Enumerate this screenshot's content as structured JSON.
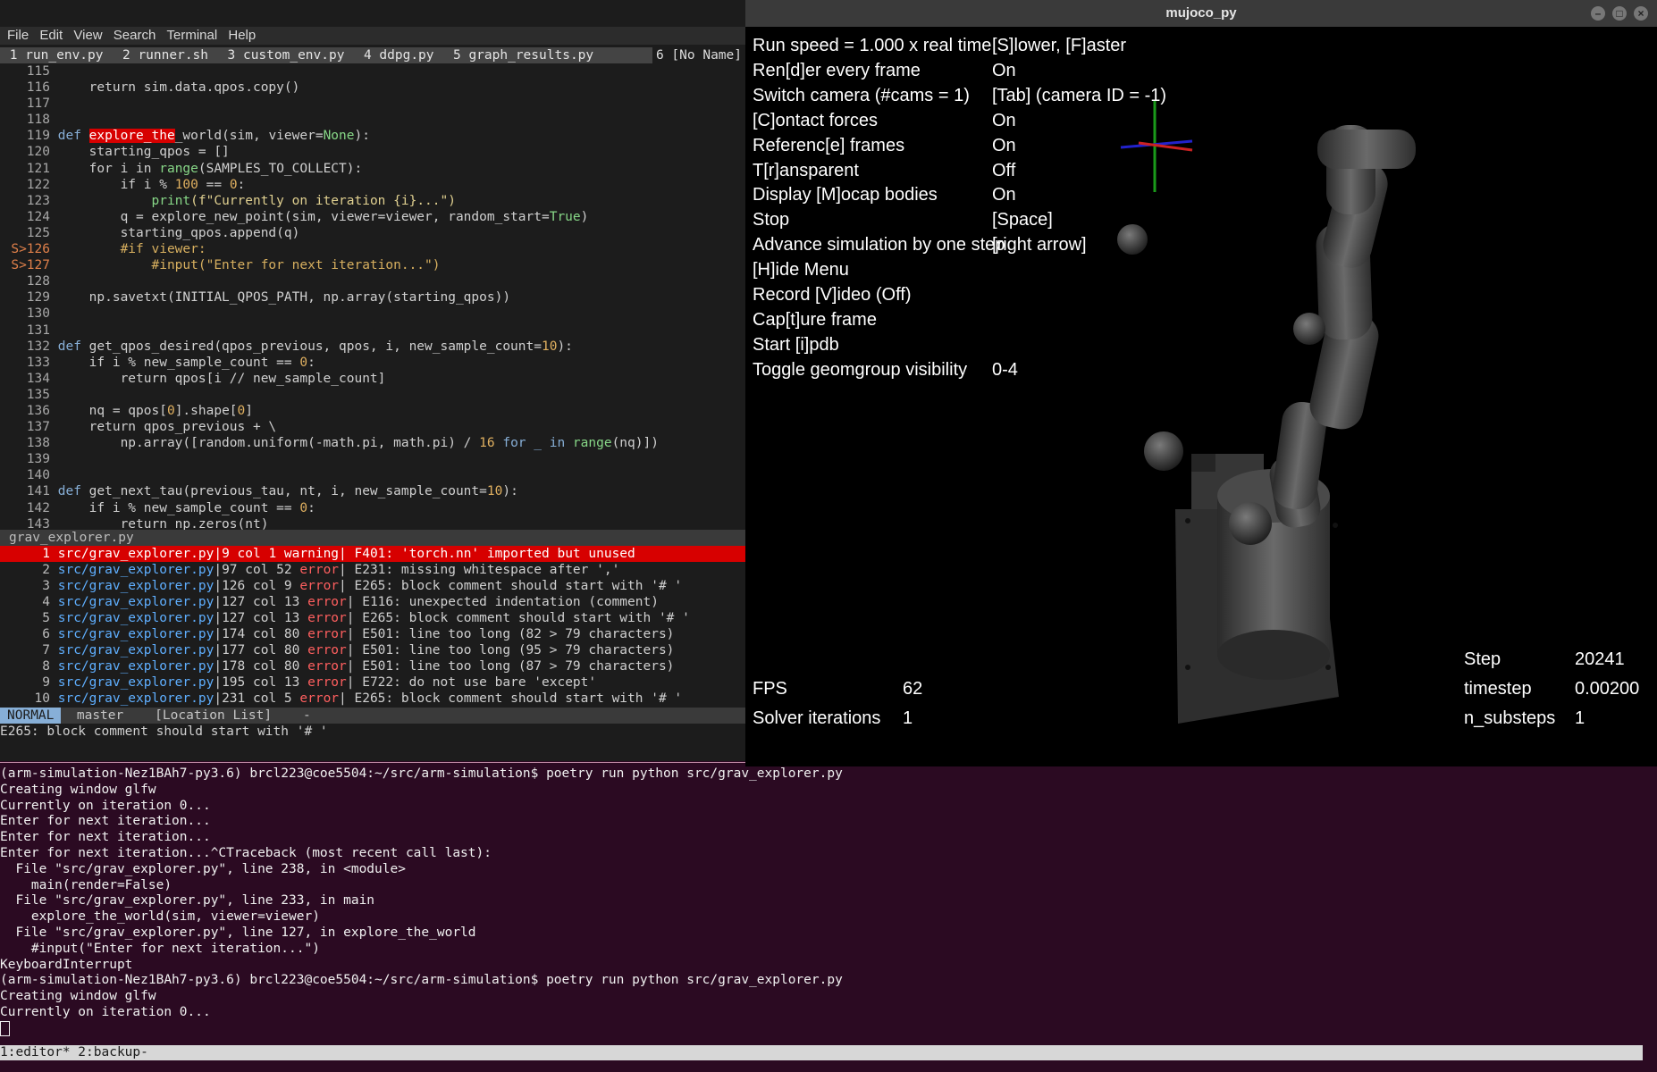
{
  "menubar": [
    "File",
    "Edit",
    "View",
    "Search",
    "Terminal",
    "Help"
  ],
  "tabs": [
    {
      "num": "1",
      "label": "run_env.py"
    },
    {
      "num": "2",
      "label": "runner.sh"
    },
    {
      "num": "3",
      "label": "custom_env.py"
    },
    {
      "num": "4",
      "label": "ddpg.py"
    },
    {
      "num": "5",
      "label": "graph_results.py"
    },
    {
      "num": "6",
      "label": "[No Name]"
    }
  ],
  "code": {
    "l115": "115",
    "l116": "116",
    "l117": "117",
    "l118": "118",
    "l119": "119",
    "l120": "120",
    "l121": "121",
    "l122": "122",
    "l123": "123",
    "l124": "124",
    "l125": "125",
    "l126": "S>126",
    "l127": "S>127",
    "l128": "128",
    "l129": "129",
    "l130": "130",
    "l131": "131",
    "l132": "132",
    "l133": "133",
    "l134": "134",
    "l135": "135",
    "l136": "136",
    "l137": "137",
    "l138": "138",
    "l139": "139",
    "l140": "140",
    "l141": "141",
    "l142": "142",
    "l143": "143",
    "t116": "    return sim.data.qpos.copy()",
    "t119_def": "def ",
    "t119_name": "explore_the",
    "t119_rest": "_world(sim, viewer=",
    "t119_none": "None",
    "t119_end": "):",
    "t120": "    starting_qpos = []",
    "t121_a": "    for i in ",
    "t121_b": "range",
    "t121_c": "(SAMPLES_TO_COLLECT):",
    "t122_a": "        if i % ",
    "t122_b": "100",
    "t122_c": " == ",
    "t122_d": "0",
    "t122_e": ":",
    "t123_a": "            ",
    "t123_b": "print",
    "t123_c": "(f\"Currently on iteration {i}...\")",
    "t124_a": "        q = explore_new_point(sim, viewer=viewer, random_start=",
    "t124_b": "True",
    "t124_c": ")",
    "t125": "        starting_qpos.append(q)",
    "t126": "        #if viewer:",
    "t127": "            #input(\"Enter for next iteration...\")",
    "t129": "    np.savetxt(INITIAL_QPOS_PATH, np.array(starting_qpos))",
    "t132_a": "def ",
    "t132_b": "get_qpos_desired(qpos_previous, qpos, i, new_sample_count=",
    "t132_c": "10",
    "t132_d": "):",
    "t133_a": "    if i % new_sample_count == ",
    "t133_b": "0",
    "t133_c": ":",
    "t134": "        return qpos[i // new_sample_count]",
    "t136_a": "    nq = qpos[",
    "t136_b": "0",
    "t136_c": "].shape[",
    "t136_d": "0",
    "t136_e": "]",
    "t137": "    return qpos_previous + \\",
    "t138_a": "        np.array([random.uniform(-math.pi, math.pi) / ",
    "t138_b": "16",
    "t138_c": " for _ in ",
    "t138_d": "range",
    "t138_e": "(nq)])",
    "t141_a": "def ",
    "t141_b": "get_next_tau(previous_tau, nt, i, new_sample_count=",
    "t141_c": "10",
    "t141_d": "):",
    "t142_a": "    if i % new_sample_count == ",
    "t142_b": "0",
    "t142_c": ":",
    "t143": "        return np.zeros(nt)"
  },
  "status1": "grav_explorer.py",
  "loclist": [
    {
      "n": "1",
      "file": "src/grav_explorer.py",
      "pos": "|9 col 1 ",
      "level": "warning",
      "msg": "| F401: 'torch.nn' imported but unused"
    },
    {
      "n": "2",
      "file": "src/grav_explorer.py",
      "pos": "|97 col 52 ",
      "level": "error",
      "msg": "| E231: missing whitespace after ','"
    },
    {
      "n": "3",
      "file": "src/grav_explorer.py",
      "pos": "|126 col 9 ",
      "level": "error",
      "msg": "| E265: block comment should start with '# '"
    },
    {
      "n": "4",
      "file": "src/grav_explorer.py",
      "pos": "|127 col 13 ",
      "level": "error",
      "msg": "| E116: unexpected indentation (comment)"
    },
    {
      "n": "5",
      "file": "src/grav_explorer.py",
      "pos": "|127 col 13 ",
      "level": "error",
      "msg": "| E265: block comment should start with '# '"
    },
    {
      "n": "6",
      "file": "src/grav_explorer.py",
      "pos": "|174 col 80 ",
      "level": "error",
      "msg": "| E501: line too long (82 > 79 characters)"
    },
    {
      "n": "7",
      "file": "src/grav_explorer.py",
      "pos": "|177 col 80 ",
      "level": "error",
      "msg": "| E501: line too long (95 > 79 characters)"
    },
    {
      "n": "8",
      "file": "src/grav_explorer.py",
      "pos": "|178 col 80 ",
      "level": "error",
      "msg": "| E501: line too long (87 > 79 characters)"
    },
    {
      "n": "9",
      "file": "src/grav_explorer.py",
      "pos": "|195 col 13 ",
      "level": "error",
      "msg": "| E722: do not use bare 'except'"
    },
    {
      "n": "10",
      "file": "src/grav_explorer.py",
      "pos": "|231 col 5 ",
      "level": "error",
      "msg": "| E265: block comment should start with '# '"
    }
  ],
  "status2": {
    "mode": "NORMAL",
    "branch": "master",
    "buffer": "[Location List]",
    "flag": "-"
  },
  "cmdline": "E265: block comment should start with '# '",
  "terminal": [
    "(arm-simulation-Nez1BAh7-py3.6) brcl223@coe5504:~/src/arm-simulation$ poetry run python src/grav_explorer.py",
    "Creating window glfw",
    "Currently on iteration 0...",
    "Enter for next iteration...",
    "Enter for next iteration...",
    "Enter for next iteration...^CTraceback (most recent call last):",
    "  File \"src/grav_explorer.py\", line 238, in <module>",
    "    main(render=False)",
    "  File \"src/grav_explorer.py\", line 233, in main",
    "    explore_the_world(sim, viewer=viewer)",
    "  File \"src/grav_explorer.py\", line 127, in explore_the_world",
    "    #input(\"Enter for next iteration...\")",
    "KeyboardInterrupt",
    "(arm-simulation-Nez1BAh7-py3.6) brcl223@coe5504:~/src/arm-simulation$ poetry run python src/grav_explorer.py",
    "Creating window glfw",
    "Currently on iteration 0..."
  ],
  "tmux": "1:editor* 2:backup-",
  "mujoco": {
    "title": "mujoco_py",
    "menu": [
      {
        "key": "Run speed = 1.000 x real time",
        "val": "[S]lower, [F]aster"
      },
      {
        "key": "Ren[d]er every frame",
        "val": "On"
      },
      {
        "key": "Switch camera (#cams = 1)",
        "val": "[Tab] (camera ID = -1)"
      },
      {
        "key": "[C]ontact forces",
        "val": "On"
      },
      {
        "key": "Referenc[e] frames",
        "val": "On"
      },
      {
        "key": "T[r]ansparent",
        "val": "Off"
      },
      {
        "key": "Display [M]ocap bodies",
        "val": "On"
      },
      {
        "key": "Stop",
        "val": "[Space]"
      },
      {
        "key": "Advance simulation by one step",
        "val": "[right arrow]"
      },
      {
        "key": "[H]ide Menu",
        "val": ""
      },
      {
        "key": "Record [V]ideo (Off)",
        "val": ""
      },
      {
        "key": "Cap[t]ure frame",
        "val": ""
      },
      {
        "key": "Start [i]pdb",
        "val": ""
      },
      {
        "key": "Toggle geomgroup visibility",
        "val": "0-4"
      }
    ],
    "fps_label": "FPS",
    "fps_val": "62",
    "solver_label": "Solver iterations",
    "solver_val": "1",
    "step_label": "Step",
    "step_val": "20241",
    "timestep_label": "timestep",
    "timestep_val": "0.00200",
    "substeps_label": "n_substeps",
    "substeps_val": "1"
  },
  "colors": {
    "error": "#ff5f5f",
    "file": "#5fafff",
    "highlight": "#d70000",
    "terminal_bg": "#2b0a22"
  }
}
